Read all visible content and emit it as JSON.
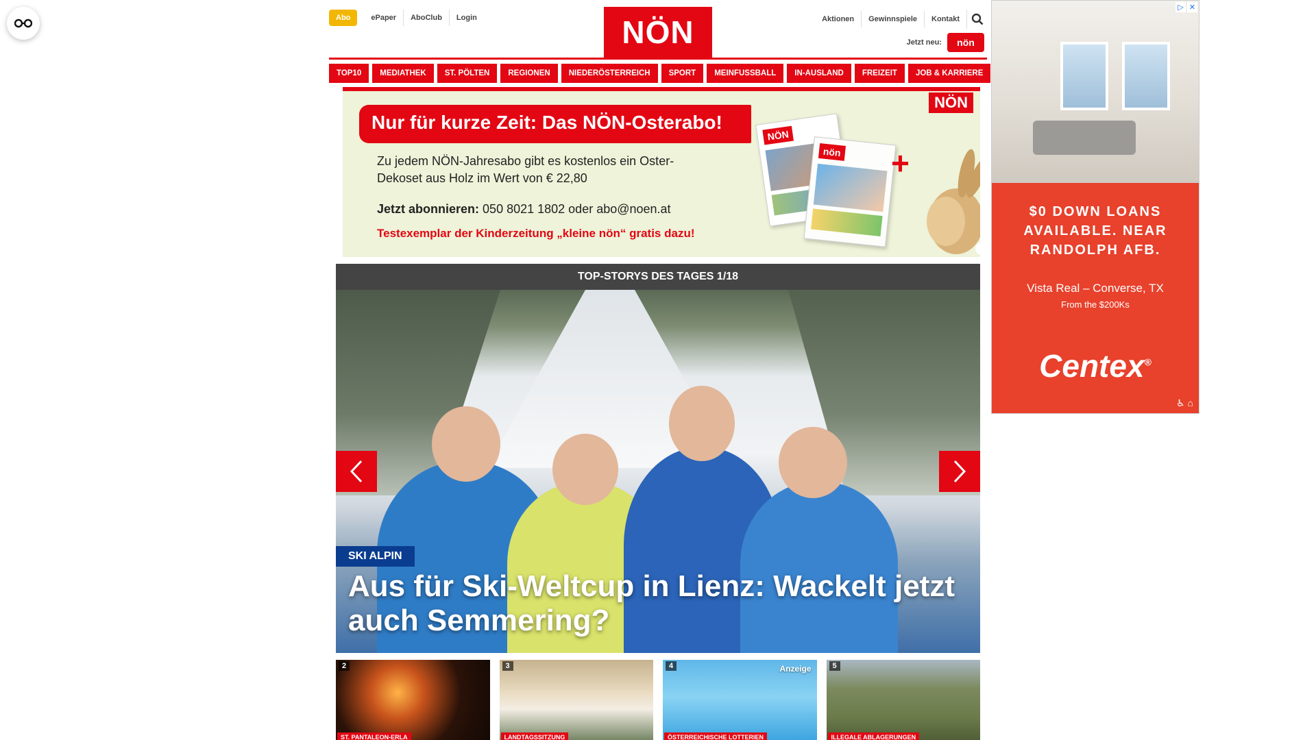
{
  "accessibility": {
    "icon": "accessibility-glasses-icon"
  },
  "header": {
    "abo_label": "Abo",
    "left_links": [
      "ePaper",
      "AboClub",
      "Login"
    ],
    "logo_text": "NÖN",
    "right_links": [
      "Aktionen",
      "Gewinnspiele",
      "Kontakt"
    ],
    "search_icon": "search-icon",
    "jetzt_label": "Jetzt neu:",
    "kleine_logo": "nön"
  },
  "nav": {
    "items": [
      "TOP10",
      "MEDIATHEK",
      "ST. PÖLTEN",
      "REGIONEN",
      "NIEDERÖSTERREICH",
      "SPORT",
      "MEINFUSSBALL",
      "IN-AUSLAND",
      "FREIZEIT",
      "JOB & KARRIERE"
    ]
  },
  "promo": {
    "title": "Nur für kurze Zeit: Das NÖN-Osterabo!",
    "body": "Zu jedem NÖN-Jahresabo gibt es kostenlos ein Oster-Dekoset aus Holz im Wert von € 22,80",
    "call_bold": "Jetzt abonnieren:",
    "call_rest": "050 8021 1802 oder abo@noen.at",
    "free": "Testexemplar der Kinderzeitung „kleine nön“ gratis dazu!",
    "logo": "NÖN",
    "paper_logo": "NÖN",
    "plus": "+"
  },
  "stories": {
    "heading": "TOP-STORYS DES TAGES 1/18",
    "hero": {
      "tag": "SKI ALPIN",
      "title": "Aus für Ski-Weltcup in Lienz: Wackelt jetzt auch Semmering?"
    },
    "thumbs": [
      {
        "num": "2",
        "category": "ST. PANTALEON-ERLA",
        "ad": ""
      },
      {
        "num": "3",
        "category": "LANDTAGSSITZUNG",
        "ad": ""
      },
      {
        "num": "4",
        "category": "ÖSTERREICHISCHE LOTTERIEN",
        "ad": "Anzeige"
      },
      {
        "num": "5",
        "category": "ILLEGALE ABLAGERUNGEN",
        "ad": ""
      }
    ]
  },
  "sidead": {
    "headline": "$0 DOWN LOANS AVAILABLE. NEAR RANDOLPH AFB.",
    "location": "Vista Real – Converse, TX",
    "price": "From the $200Ks",
    "brand": "Centex",
    "brand_mark": "®",
    "icons": "♿ ⌂"
  }
}
